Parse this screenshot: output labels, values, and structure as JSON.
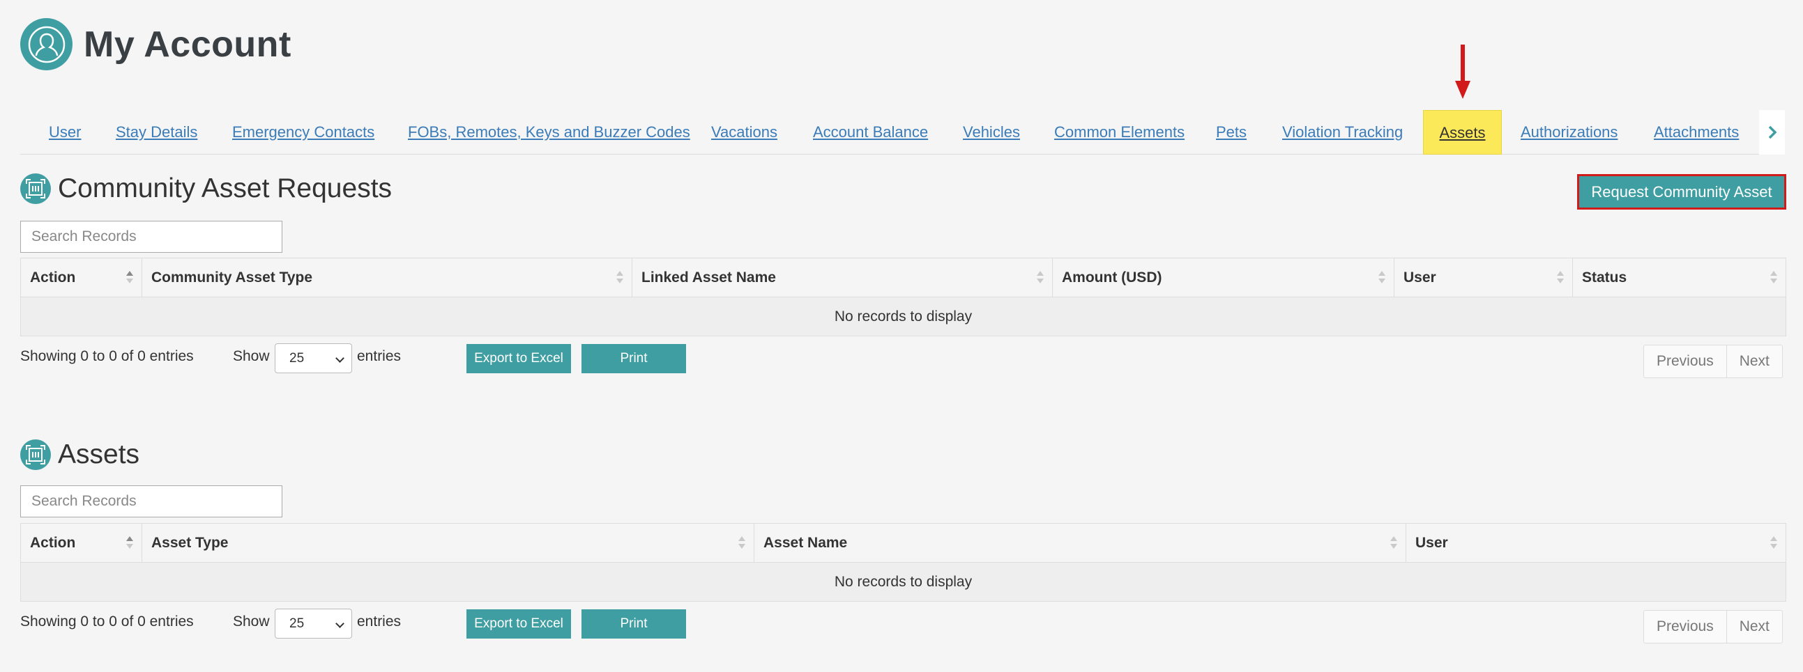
{
  "page": {
    "title": "My Account",
    "avatar_icon": "user-avatar-icon",
    "accent_color": "#3f9ea2",
    "highlight_color": "#fce95a",
    "annotation_color": "#d11a1a"
  },
  "tabs": [
    {
      "label": "User"
    },
    {
      "label": "Stay Details"
    },
    {
      "label": "Emergency Contacts"
    },
    {
      "label": "FOBs, Remotes, Keys and Buzzer Codes"
    },
    {
      "label": "Vacations"
    },
    {
      "label": "Account Balance"
    },
    {
      "label": "Vehicles"
    },
    {
      "label": "Common Elements"
    },
    {
      "label": "Pets"
    },
    {
      "label": "Violation Tracking"
    },
    {
      "label": "Assets",
      "active": true
    },
    {
      "label": "Authorizations"
    },
    {
      "label": "Attachments"
    }
  ],
  "tabs_next_icon": "chevron-right-icon",
  "community_requests": {
    "title": "Community Asset Requests",
    "icon": "assets-icon",
    "request_button": "Request Community Asset",
    "search_placeholder": "Search Records",
    "columns": [
      "Action",
      "Community Asset Type",
      "Linked Asset Name",
      "Amount (USD)",
      "User",
      "Status"
    ],
    "empty_text": "No records to display",
    "showing_text": "Showing 0 to 0 of 0 entries",
    "show_label": "Show",
    "page_size": "25",
    "entries_label": "entries",
    "export_label": "Export to Excel",
    "print_label": "Print",
    "previous_label": "Previous",
    "next_label": "Next"
  },
  "assets": {
    "title": "Assets",
    "icon": "assets-icon",
    "search_placeholder": "Search Records",
    "columns": [
      "Action",
      "Asset Type",
      "Asset Name",
      "User"
    ],
    "empty_text": "No records to display",
    "showing_text": "Showing 0 to 0 of 0 entries",
    "show_label": "Show",
    "page_size": "25",
    "entries_label": "entries",
    "export_label": "Export to Excel",
    "print_label": "Print",
    "previous_label": "Previous",
    "next_label": "Next"
  }
}
